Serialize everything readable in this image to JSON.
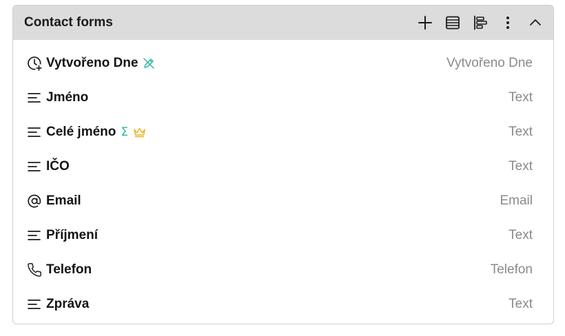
{
  "panel": {
    "title": "Contact forms",
    "actions": [
      "plus-icon",
      "table-icon",
      "align-left-icon",
      "more-vertical-icon",
      "chevron-up-icon"
    ]
  },
  "fields": [
    {
      "label": "Vytvořeno Dne",
      "type": "Vytvořeno Dne",
      "icon": "clock-plus-icon",
      "badges": [
        "pencil-off-icon"
      ]
    },
    {
      "label": "Jméno",
      "type": "Text",
      "icon": "text-lines-icon",
      "badges": []
    },
    {
      "label": "Celé jméno",
      "type": "Text",
      "icon": "text-lines-icon",
      "badges": [
        "sigma-icon",
        "crown-icon"
      ]
    },
    {
      "label": "IČO",
      "type": "Text",
      "icon": "text-lines-icon",
      "badges": []
    },
    {
      "label": "Email",
      "type": "Email",
      "icon": "at-sign-icon",
      "badges": []
    },
    {
      "label": "Příjmení",
      "type": "Text",
      "icon": "text-lines-icon",
      "badges": []
    },
    {
      "label": "Telefon",
      "type": "Telefon",
      "icon": "phone-icon",
      "badges": []
    },
    {
      "label": "Zpráva",
      "type": "Text",
      "icon": "text-lines-icon",
      "badges": []
    }
  ],
  "colors": {
    "header_bg": "#dcdcdc",
    "accent_teal": "#2bb5a0",
    "crown_gold": "#e6b422",
    "type_text": "#8a8a8a"
  }
}
